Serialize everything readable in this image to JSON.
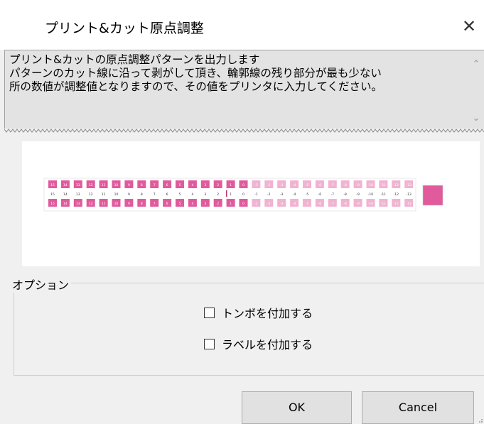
{
  "window": {
    "title": "プリント&カット原点調整",
    "close_label": "✕"
  },
  "description": {
    "text": "プリント&カットの原点調整パターンを出力します\nパターンのカット線に沿って剥がして頂き、輪郭線の残り部分が最も少ない\n所の数値が調整値となりますので、その値をプリンタに入力してください。",
    "scroll_up_icon": "chevron-up-icon",
    "scroll_down_icon": "chevron-down-icon"
  },
  "preview": {
    "numbers": [
      "15",
      "14",
      "13",
      "12",
      "11",
      "10",
      "9",
      "8",
      "7",
      "6",
      "5",
      "4",
      "3",
      "2",
      "1",
      "0",
      "-1",
      "-2",
      "-3",
      "-4",
      "-5",
      "-6",
      "-7",
      "-8",
      "-9",
      "-10",
      "-11",
      "-12",
      "-13"
    ],
    "pink_count": 16,
    "pink_color": "#e05a9c",
    "light_pink_color": "#f0b3d1",
    "marker_color": "#e05a9c"
  },
  "options": {
    "label": "オプション",
    "checkboxes": [
      {
        "label": "トンボを付加する",
        "checked": false
      },
      {
        "label": "ラベルを付加する",
        "checked": false
      }
    ]
  },
  "buttons": {
    "ok": "OK",
    "cancel": "Cancel"
  }
}
